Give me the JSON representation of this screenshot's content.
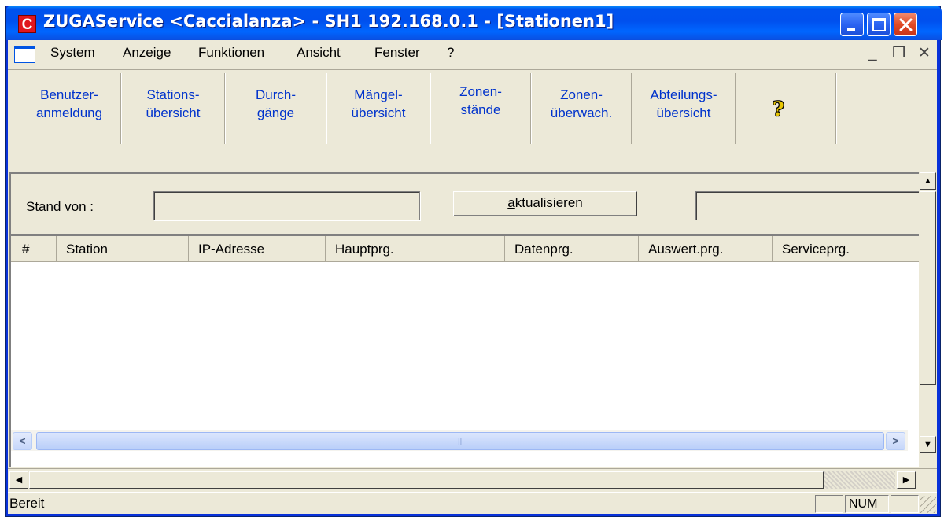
{
  "window": {
    "title": "ZUGAService <Caccialanza> - SH1 192.168.0.1 - [Stationen1]",
    "app_icon_letter": "C",
    "title_bar_color": "#0054e3",
    "close_button_color": "#e04a25"
  },
  "menu": {
    "items": [
      "System",
      "Anzeige",
      "Funktionen",
      "Ansicht",
      "Fenster",
      "?"
    ],
    "mdi_minimize": "_",
    "mdi_restore": "❐",
    "mdi_close": "✕"
  },
  "toolbar": {
    "link_color": "#0033cc",
    "buttons": [
      {
        "line1": "Benutzer-",
        "line2": "anmeldung"
      },
      {
        "line1": "Stations-",
        "line2": "übersicht"
      },
      {
        "line1": "Durch-",
        "line2": "gänge"
      },
      {
        "line1": "Mängel-",
        "line2": "übersicht"
      },
      {
        "line1": "Zonen-",
        "line2": "stände"
      },
      {
        "line1": "Zonen-",
        "line2": "überwach."
      },
      {
        "line1": "Abteilungs-",
        "line2": "übersicht"
      }
    ],
    "help_icon": "?"
  },
  "form": {
    "stand_label": "Stand von :",
    "stand_value": "",
    "refresh_prefix": "a",
    "refresh_rest": "ktualisieren",
    "side_value": ""
  },
  "table": {
    "columns": [
      "#",
      "Station",
      "IP-Adresse",
      "Hauptprg.",
      "Datenprg.",
      "Auswert.prg.",
      "Serviceprg."
    ],
    "rows": []
  },
  "statusbar": {
    "text": "Bereit",
    "pane_num": "NUM"
  }
}
